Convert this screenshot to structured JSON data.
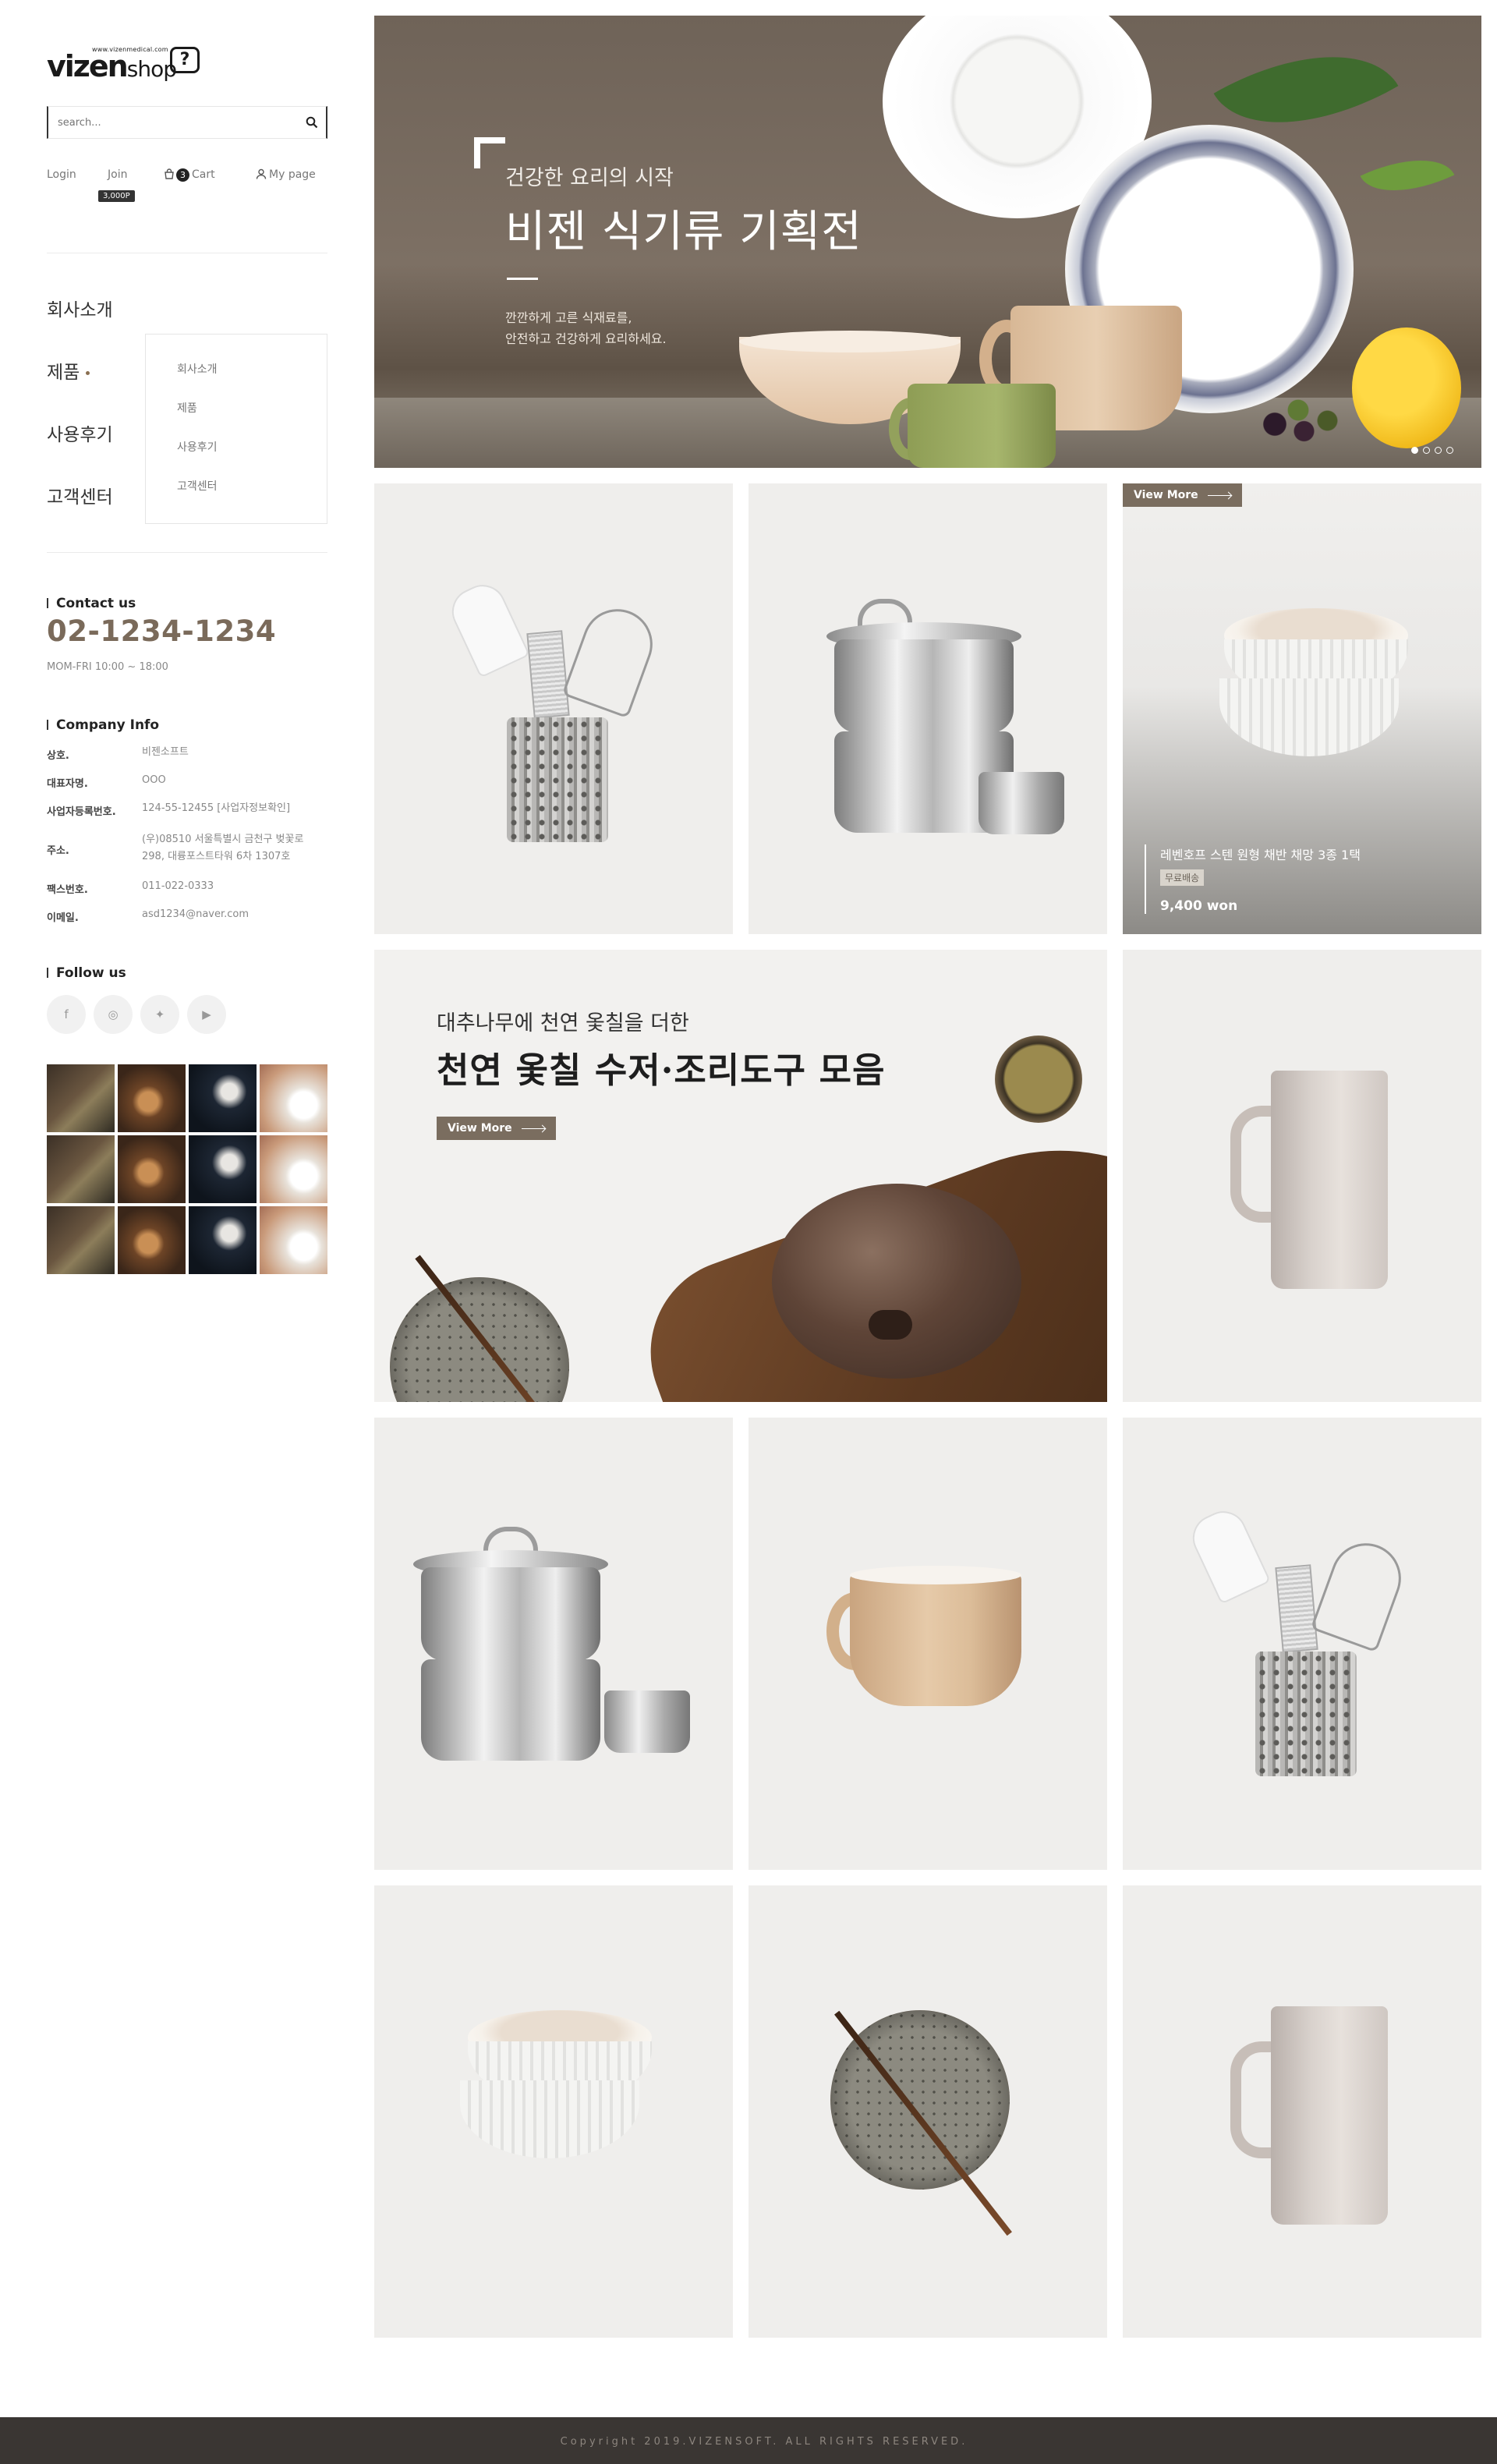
{
  "brand": {
    "domain_small": "www.vizenmedical.com",
    "logo_main": "vizen",
    "logo_shop": "shop",
    "logo_icon": "?"
  },
  "search": {
    "placeholder": "search..."
  },
  "util": {
    "login": "Login",
    "join": "Join",
    "join_points": "3,000P",
    "cart_count": "3",
    "cart": "Cart",
    "mypage": "My page"
  },
  "nav": {
    "items": [
      {
        "label": "회사소개"
      },
      {
        "label": "제품"
      },
      {
        "label": "사용후기"
      },
      {
        "label": "고객센터"
      }
    ],
    "submenu": [
      "회사소개",
      "제품",
      "사용후기",
      "고객센터"
    ]
  },
  "contact": {
    "title": "Contact us",
    "phone": "02-1234-1234",
    "hours": "MOM-FRI 10:00 ~ 18:00"
  },
  "company": {
    "title": "Company Info",
    "rows": [
      {
        "k": "상호.",
        "v": "비젠소프트"
      },
      {
        "k": "대표자명.",
        "v": "OOO"
      },
      {
        "k": "사업자등록번호.",
        "v": "124-55-12455 [사업자정보확인]"
      },
      {
        "k": "주소.",
        "v": "(우)08510 서울특별시 금천구 벚꽃로 298, 대륭포스트타워 6차 1307호"
      },
      {
        "k": "팩스번호.",
        "v": "011-022-0333"
      },
      {
        "k": "이메일.",
        "v": "asd1234@naver.com"
      }
    ]
  },
  "follow": {
    "title": "Follow us",
    "icons": [
      {
        "name": "facebook-icon",
        "glyph": "f"
      },
      {
        "name": "instagram-icon",
        "glyph": "◎"
      },
      {
        "name": "twitter-icon",
        "glyph": "✦"
      },
      {
        "name": "youtube-icon",
        "glyph": "▶"
      }
    ]
  },
  "hero": {
    "subtitle": "건강한 요리의 시작",
    "title": "비젠 식기류 기획전",
    "desc_line1": "깐깐하게 고른 식재료를,",
    "desc_line2": "안전하고 건강하게 요리하세요.",
    "slide_count": 4,
    "active_slide": 1
  },
  "featured": {
    "view_more": "View More",
    "name": "레벤호프 스텐 원형 채반 채망 3종 1택",
    "badge": "무료배송",
    "price": "9,400 won"
  },
  "promo": {
    "subtitle": "대추나무에 천연 옻칠을 더한",
    "title": "천연 옻칠 수저·조리도구 모음",
    "view_more": "View More"
  },
  "footer": {
    "copyright": "Copyright 2019.VIZENSOFT. ALL RIGHTS RESERVED."
  }
}
